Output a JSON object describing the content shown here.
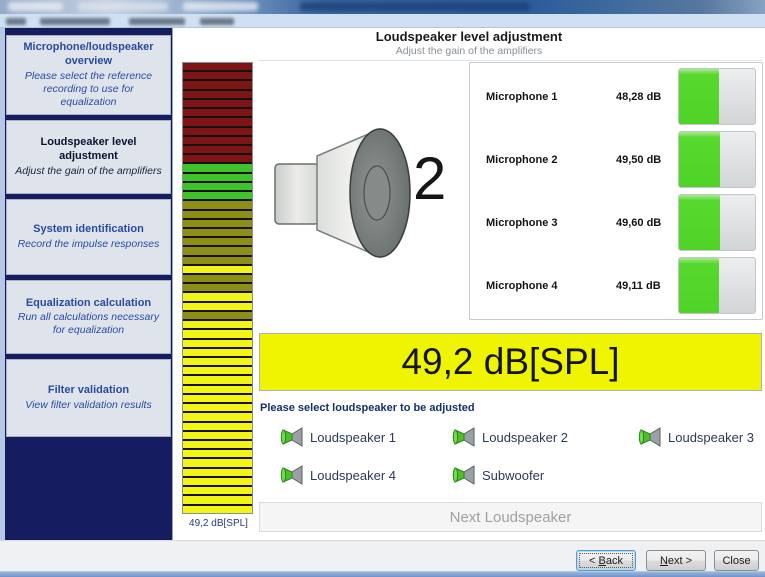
{
  "header": {
    "title": "Loudspeaker level adjustment",
    "subtitle": "Adjust the gain of the amplifiers"
  },
  "sidebar": {
    "steps": [
      {
        "title": "Microphone/loudspeaker overview",
        "subtitle": "Please select the reference recording to use for equalization",
        "active": false
      },
      {
        "title": "Loudspeaker level adjustment",
        "subtitle": "Adjust the gain of the amplifiers",
        "active": true
      },
      {
        "title": "System identification",
        "subtitle": "Record the impulse responses",
        "active": false
      },
      {
        "title": "Equalization calculation",
        "subtitle": "Run all calculations necessary for equalization",
        "active": false
      },
      {
        "title": "Filter validation",
        "subtitle": "View filter validation results",
        "active": false
      }
    ]
  },
  "meter": {
    "label": "49,2 dB[SPL]",
    "segment_colors": {
      "red": "#7d1416",
      "green": "#3fc32a",
      "olive": "#8d8e15",
      "yellow": "#f2f415"
    },
    "segments": [
      "red",
      "red",
      "red",
      "red",
      "red",
      "red",
      "red",
      "red",
      "red",
      "red",
      "red",
      "green",
      "green",
      "green",
      "green",
      "olive",
      "olive",
      "olive",
      "olive",
      "olive",
      "olive",
      "olive",
      "yellow",
      "olive",
      "olive",
      "yellow",
      "yellow",
      "olive",
      "yellow",
      "yellow",
      "yellow",
      "yellow",
      "yellow",
      "yellow",
      "yellow",
      "yellow",
      "yellow",
      "yellow",
      "yellow",
      "yellow",
      "yellow",
      "yellow",
      "yellow",
      "yellow",
      "yellow",
      "yellow",
      "yellow",
      "yellow",
      "yellow"
    ]
  },
  "speaker_number": "2",
  "microphones": [
    {
      "name": "Microphone 1",
      "value": "48,28 dB",
      "level_pct": 52
    },
    {
      "name": "Microphone 2",
      "value": "49,50 dB",
      "level_pct": 54
    },
    {
      "name": "Microphone 3",
      "value": "49,60 dB",
      "level_pct": 54
    },
    {
      "name": "Microphone 4",
      "value": "49,11 dB",
      "level_pct": 53
    }
  ],
  "spl_display": "49,2 dB[SPL]",
  "select_prompt": "Please select loudspeaker to be adjusted",
  "loudspeakers": [
    {
      "label": "Loudspeaker 1"
    },
    {
      "label": "Loudspeaker 2"
    },
    {
      "label": "Loudspeaker 3"
    },
    {
      "label": "Loudspeaker 4"
    },
    {
      "label": "Subwoofer"
    }
  ],
  "next_loudspeaker_label": "Next Loudspeaker",
  "footer": {
    "back": {
      "prefix": "< ",
      "accel": "B",
      "suffix": "ack"
    },
    "next": {
      "prefix": "",
      "accel": "N",
      "suffix": "ext >"
    },
    "close": {
      "label": "Close"
    }
  },
  "colors": {
    "sidebar_navy": "#151c5f",
    "step_text_blue": "#2b4a9e",
    "spl_yellow": "#eff400",
    "mic_green": "#4fd327",
    "titlebar_blue": "#2c5d9b"
  }
}
